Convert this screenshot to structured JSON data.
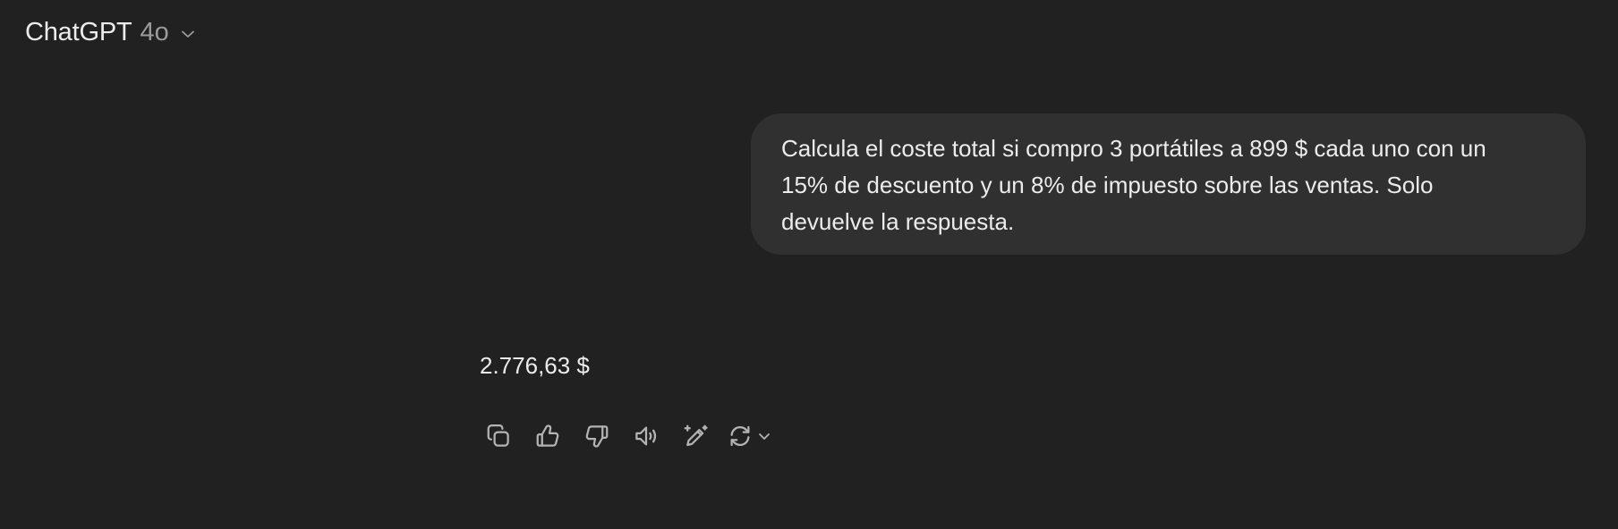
{
  "header": {
    "app_name": "ChatGPT",
    "model": "4o",
    "model_menu_icon": "chevron-down-icon"
  },
  "conversation": {
    "user_message": "Calcula el coste total si compro 3 portátiles a 899 $ cada uno con un\n15% de descuento y un 8% de impuesto sobre las ventas. Solo\ndevuelve la respuesta.",
    "assistant_message": "2.776,63 $"
  },
  "actions": [
    {
      "name": "copy-icon"
    },
    {
      "name": "thumbs-up-icon"
    },
    {
      "name": "thumbs-down-icon"
    },
    {
      "name": "read-aloud-icon"
    },
    {
      "name": "edit-sparkle-icon"
    },
    {
      "name": "regenerate-icon"
    }
  ],
  "colors": {
    "background": "#212121",
    "bubble": "#303030",
    "text": "#ececec",
    "muted": "#9b9b9b",
    "icon": "#b4b4b4"
  }
}
